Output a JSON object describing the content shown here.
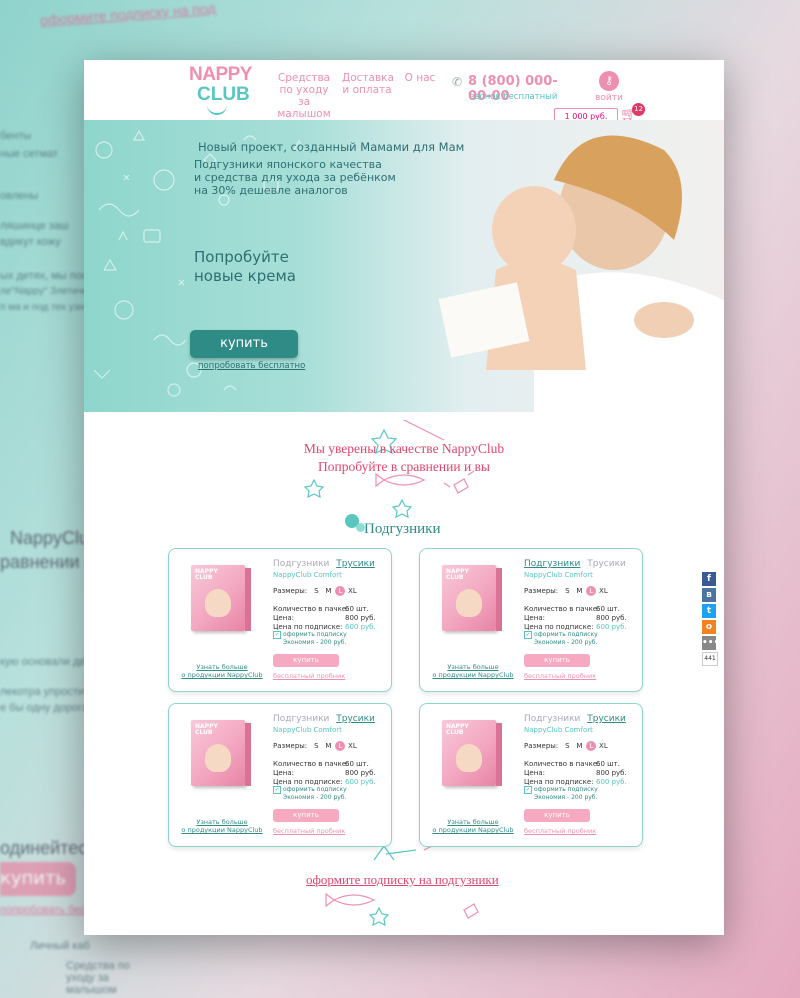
{
  "background": {
    "left_texts": [
      "оформите подписку на под",
      "бенты",
      "ные сетмат",
      "овлены",
      "ляшинце заш",
      "вдикут кожу",
      "ых детях, мы пост",
      "ле\"Nappy\" Злетичные ре",
      "п ма и под тех узнает",
      "NappyClub",
      "равнении и вы",
      "кую основали две",
      "лекотра упростить",
      "е бы одну дорога",
      "одинейтесь и вы",
      "купить",
      "попробовать беспл",
      "Личный каб",
      "Средства по уходу за малышом"
    ]
  },
  "header": {
    "logo_line1": "NAPPY",
    "logo_line2": "CLUB",
    "nav": [
      {
        "label": "Средства по уходу за малышом"
      },
      {
        "label": "Доставка и оплата"
      },
      {
        "label": "О нас"
      }
    ],
    "phone": "8 (800) 000-00-00",
    "phone_note": "звонок бесплатный",
    "login_label": "войти",
    "cart_amount": "1 000 руб.",
    "cart_count": "12"
  },
  "hero": {
    "subtitle": "Новый проект, созданный Мамами для Мам",
    "desc_line1": "Подгузники японского качества",
    "desc_line2": "и средства для ухода за ребёнком",
    "desc_line3": "на 30% дешевле аналогов",
    "try_line1": "Попробуйте",
    "try_line2": "новые крема",
    "buy_label": "купить",
    "try_free_label": "попробовать бесплатно"
  },
  "tagline": {
    "line1": "Мы уверены в качестве NappyClub",
    "line2": "Попробуйте в сравнении и вы"
  },
  "section_title": "Подгузники",
  "products": [
    {
      "tab1": "Подгузники",
      "tab2": "Трусики",
      "active_tab": "Трусики",
      "model": "NappyClub Comfort",
      "sizes_label": "Размеры:",
      "sizes": [
        "S",
        "M",
        "L",
        "XL"
      ],
      "selected_size": "L",
      "qty_label": "Количество в пачке:",
      "qty": "60 шт.",
      "price_label": "Цена:",
      "price": "800 руб.",
      "sub_price_label": "Цена по подписке:",
      "sub_price": "600 руб.",
      "subscribe": "оформить подписку",
      "economy": "Экономия - 200 руб.",
      "buy": "купить",
      "trial": "бесплатный пробник",
      "more_line1": "Узнать больше",
      "more_line2": "о продукции NappyClub",
      "box_brand1": "NAPPY",
      "box_brand2": "CLUB"
    },
    {
      "tab1": "Подгузники",
      "tab2": "Трусики",
      "active_tab": "Подгузники",
      "model": "NappyClub Comfort",
      "sizes_label": "Размеры:",
      "sizes": [
        "S",
        "M",
        "L",
        "XL"
      ],
      "selected_size": "L",
      "qty_label": "Количество в пачке:",
      "qty": "60 шт.",
      "price_label": "Цена:",
      "price": "800 руб.",
      "sub_price_label": "Цена по подписке:",
      "sub_price": "600 руб.",
      "subscribe": "оформить подписку",
      "economy": "Экономия - 200 руб.",
      "buy": "купить",
      "trial": "бесплатный пробник",
      "more_line1": "Узнать больше",
      "more_line2": "о продукции NappyClub",
      "box_brand1": "NAPPY",
      "box_brand2": "CLUB"
    },
    {
      "tab1": "Подгузники",
      "tab2": "Трусики",
      "active_tab": "Трусики",
      "model": "NappyClub Comfort",
      "sizes_label": "Размеры:",
      "sizes": [
        "S",
        "M",
        "L",
        "XL"
      ],
      "selected_size": "L",
      "qty_label": "Количество в пачке:",
      "qty": "60 шт.",
      "price_label": "Цена:",
      "price": "800 руб.",
      "sub_price_label": "Цена по подписке:",
      "sub_price": "600 руб.",
      "subscribe": "оформить подписку",
      "economy": "Экономия - 200 руб.",
      "buy": "купить",
      "trial": "бесплатный пробник",
      "more_line1": "Узнать больше",
      "more_line2": "о продукции NappyClub",
      "box_brand1": "NAPPY",
      "box_brand2": "CLUB"
    },
    {
      "tab1": "Подгузники",
      "tab2": "Трусики",
      "active_tab": "Трусики",
      "model": "NappyClub Comfort",
      "sizes_label": "Размеры:",
      "sizes": [
        "S",
        "M",
        "L",
        "XL"
      ],
      "selected_size": "L",
      "qty_label": "Количество в пачке:",
      "qty": "60 шт.",
      "price_label": "Цена:",
      "price": "800 руб.",
      "sub_price_label": "Цена по подписке:",
      "sub_price": "600 руб.",
      "subscribe": "оформить подписку",
      "economy": "Экономия - 200 руб.",
      "buy": "купить",
      "trial": "бесплатный пробник",
      "more_line1": "Узнать больше",
      "more_line2": "о продукции NappyClub",
      "box_brand1": "NAPPY",
      "box_brand2": "CLUB"
    }
  ],
  "bottom_link": "оформите подписку на подгузники",
  "social": {
    "icons": [
      {
        "name": "facebook-icon",
        "glyph": "f",
        "color": "#3b5998"
      },
      {
        "name": "vk-icon",
        "glyph": "в",
        "color": "#4c75a3"
      },
      {
        "name": "twitter-icon",
        "glyph": "t",
        "color": "#1da1f2"
      },
      {
        "name": "odnoklassniki-icon",
        "glyph": "о",
        "color": "#f58220"
      },
      {
        "name": "more-icon",
        "glyph": "•••",
        "color": "#888888"
      }
    ],
    "count": "441"
  },
  "colors": {
    "pink": "#ef8fb0",
    "teal": "#58c7c0",
    "dark_teal": "#2f8b86",
    "accent_red": "#e0466e"
  }
}
